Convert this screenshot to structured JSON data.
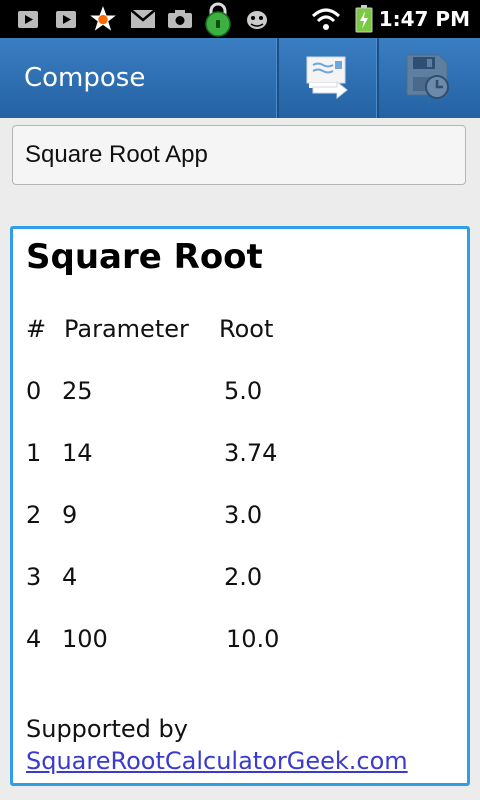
{
  "status_bar": {
    "time": "1:47 PM",
    "icons": [
      "play-store-icon",
      "play-store-icon",
      "star-notification-icon",
      "gmail-icon",
      "camera-icon",
      "lock-icon",
      "bug-icon",
      "wifi-icon",
      "battery-icon"
    ],
    "colors": {
      "background": "#000000",
      "lock": "#3cb043",
      "battery": "#7ac943",
      "star": "#ff6a00"
    }
  },
  "action_bar": {
    "title": "Compose",
    "actions": [
      "send-icon",
      "save-draft-icon"
    ],
    "colors": {
      "background": "#2e70b3"
    }
  },
  "subject": {
    "value": "Square Root App"
  },
  "body": {
    "title": "Square Root",
    "table": {
      "headers": [
        "#",
        "Parameter",
        "Root"
      ],
      "rows": [
        [
          "0",
          "25",
          "5.0"
        ],
        [
          "1",
          "14",
          "3.74"
        ],
        [
          "2",
          "9",
          "3.0"
        ],
        [
          "3",
          "4",
          "2.0"
        ],
        [
          "4",
          "100",
          "10.0"
        ]
      ]
    },
    "supported_by": "Supported by",
    "link_text": "SquareRootCalculatorGeek.com",
    "colors": {
      "border": "#2e9fe6",
      "link": "#3a3ad0"
    }
  }
}
